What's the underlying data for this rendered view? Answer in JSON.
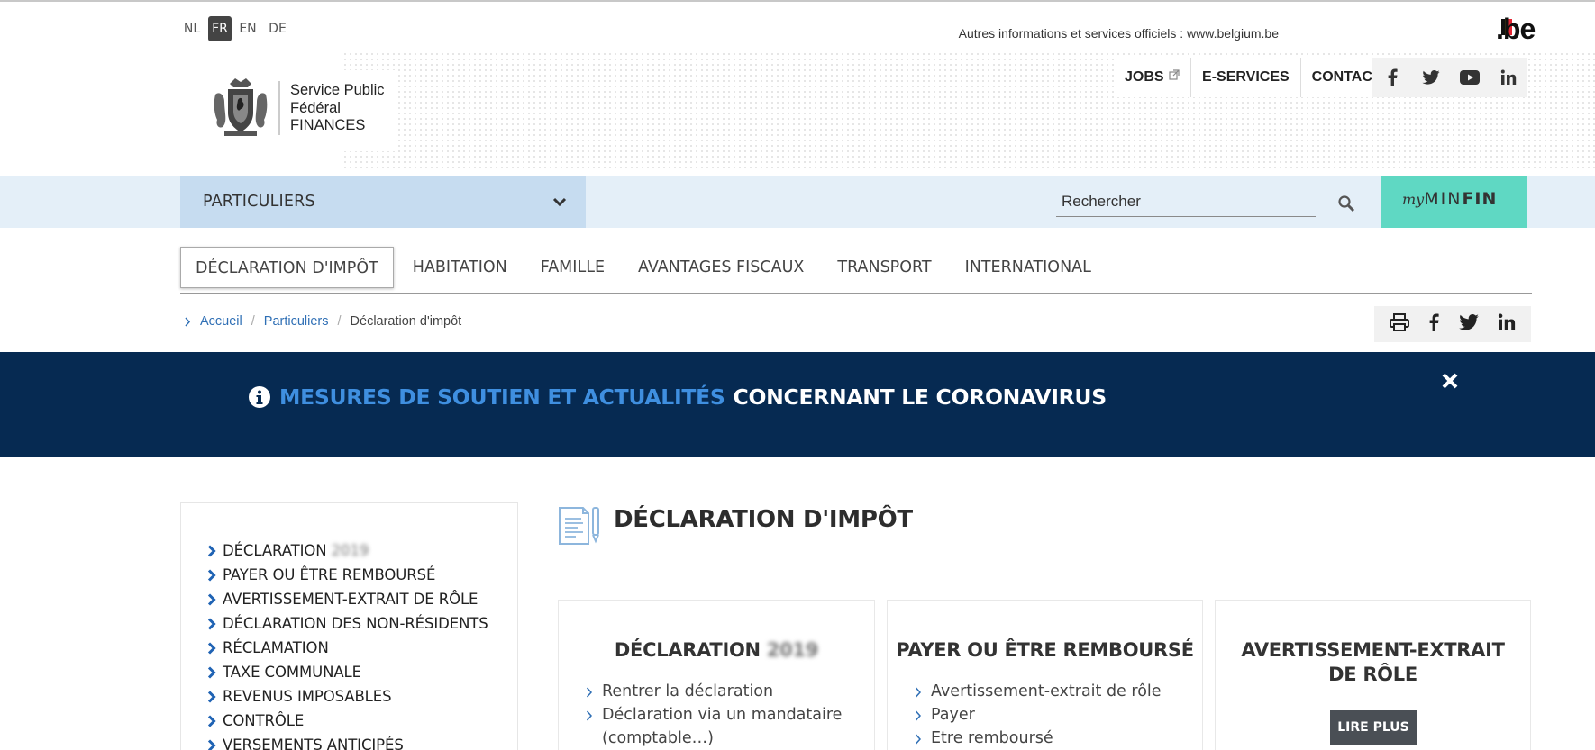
{
  "languages": [
    "NL",
    "FR",
    "EN",
    "DE"
  ],
  "active_language": "FR",
  "belgium_link_text": "Autres informations et services officiels : www.belgium.be",
  "be_logo_text": ".be",
  "logo": {
    "line1": "Service Public",
    "line2": "Fédéral",
    "line3": "FINANCES"
  },
  "top_links": {
    "jobs": "JOBS",
    "eservices": "E-SERVICES",
    "contact": "CONTACT"
  },
  "social_icons": [
    "facebook-icon",
    "twitter-icon",
    "youtube-icon",
    "linkedin-icon"
  ],
  "audience_select": {
    "selected": "PARTICULIERS"
  },
  "search": {
    "placeholder": "Rechercher"
  },
  "myminfin": {
    "prefix": "my",
    "main": "MIN",
    "bold": "FIN"
  },
  "main_menu": [
    {
      "label": "DÉCLARATION D'IMPÔT",
      "active": true
    },
    {
      "label": "HABITATION"
    },
    {
      "label": "FAMILLE"
    },
    {
      "label": "AVANTAGES FISCAUX"
    },
    {
      "label": "TRANSPORT"
    },
    {
      "label": "INTERNATIONAL"
    }
  ],
  "breadcrumb": {
    "home": "Accueil",
    "section": "Particuliers",
    "current": "Déclaration d'impôt"
  },
  "banner": {
    "highlight": "MESURES DE SOUTIEN ET ACTUALITÉS",
    "rest": "CONCERNANT LE CORONAVIRUS"
  },
  "sidebar": {
    "items": [
      {
        "label": "DÉCLARATION",
        "blurred": "2019"
      },
      {
        "label": "PAYER OU ÊTRE REMBOURSÉ"
      },
      {
        "label": "AVERTISSEMENT-EXTRAIT DE RÔLE"
      },
      {
        "label": "DÉCLARATION DES NON-RÉSIDENTS"
      },
      {
        "label": "RÉCLAMATION"
      },
      {
        "label": "TAXE COMMUNALE"
      },
      {
        "label": "REVENUS IMPOSABLES"
      },
      {
        "label": "CONTRÔLE"
      },
      {
        "label": "VERSEMENTS ANTICIPÉS"
      }
    ]
  },
  "page_title": "DÉCLARATION D'IMPÔT",
  "cards": [
    {
      "title": "DÉCLARATION",
      "title_blurred": "2019",
      "links": [
        "Rentrer la déclaration",
        "Déclaration via un mandataire (comptable…)"
      ]
    },
    {
      "title": "PAYER OU ÊTRE REMBOURSÉ",
      "links": [
        "Avertissement-extrait de rôle",
        "Payer",
        "Etre remboursé"
      ]
    },
    {
      "title_line1": "AVERTISSEMENT-EXTRAIT",
      "title_line2": "DE RÔLE",
      "button": "LIRE PLUS"
    }
  ]
}
